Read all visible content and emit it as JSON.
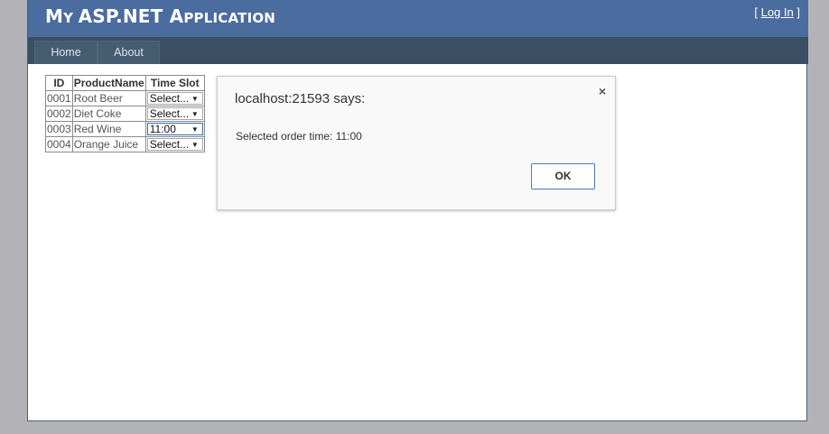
{
  "header": {
    "title_parts": [
      {
        "text": "M",
        "size": "big"
      },
      {
        "text": "Y ",
        "size": "small"
      },
      {
        "text": "ASP.NET ",
        "size": "big"
      },
      {
        "text": "A",
        "size": "big"
      },
      {
        "text": "PPLICATION",
        "size": "small"
      }
    ],
    "login_open": "[ ",
    "login_label": "Log In",
    "login_close": " ]"
  },
  "nav": {
    "items": [
      {
        "label": "Home"
      },
      {
        "label": "About"
      }
    ]
  },
  "grid": {
    "columns": [
      "ID",
      "ProductName",
      "Time Slot"
    ],
    "rows": [
      {
        "id": "0001",
        "name": "Root Beer",
        "slot": "Select..."
      },
      {
        "id": "0002",
        "name": "Diet Coke",
        "slot": "Select..."
      },
      {
        "id": "0003",
        "name": "Red Wine",
        "slot": "11:00"
      },
      {
        "id": "0004",
        "name": "Orange Juice",
        "slot": "Select..."
      }
    ]
  },
  "dialog": {
    "title": "localhost:21593 says:",
    "close_glyph": "×",
    "message": "Selected order time: 11:00",
    "ok_label": "OK"
  },
  "icons": {
    "dropdown": "chevron-down-icon",
    "close": "close-icon"
  },
  "colors": {
    "header_bg": "#4b6c9e",
    "nav_bg": "#3a4f63",
    "page_bg": "#b3b3b7",
    "ok_border": "#4a78bd"
  }
}
